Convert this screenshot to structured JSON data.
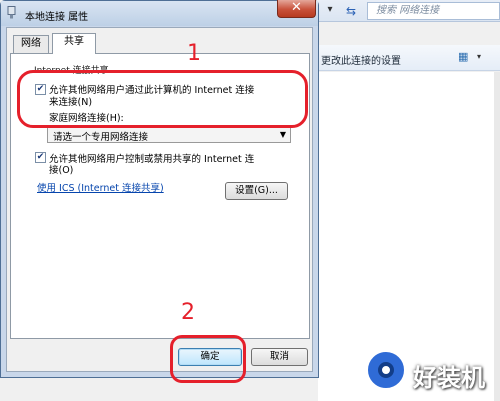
{
  "background": {
    "chevron": "▾",
    "search_placeholder": "搜索 网络连接",
    "toolbar_label": "更改此连接的设置",
    "view_icon": "view-options-icon"
  },
  "dialog": {
    "title": "本地连接 属性",
    "close_label": "✕",
    "tabs": [
      {
        "label": "网络",
        "selected": false
      },
      {
        "label": "共享",
        "selected": true
      }
    ],
    "group_label": "Internet 连接共享",
    "allow_share_line1": "允许其他网络用户通过此计算机的 Internet 连接",
    "allow_share_line2": "来连接(N)",
    "allow_share_checked": true,
    "home_network_label": "家庭网络连接(H):",
    "home_network_value": "请选一个专用网络连接",
    "allow_control_line1": "允许其他网络用户控制或禁用共享的 Internet 连",
    "allow_control_line2": "接(O)",
    "allow_control_checked": true,
    "ics_link": "使用 ICS (Internet 连接共享)",
    "settings_button": "设置(G)...",
    "ok_button": "确定",
    "cancel_button": "取消"
  },
  "annotations": {
    "marker1": "1",
    "marker2": "2",
    "color": "#e5202b"
  },
  "watermark": {
    "text": "好装机"
  }
}
